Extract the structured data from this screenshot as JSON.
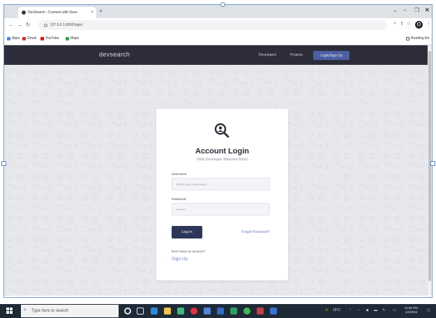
{
  "browser": {
    "tab_title": "DevSearch - Connect with Devs",
    "tab_close": "×",
    "new_tab": "+",
    "url": "127.0.0.1:8000/login/",
    "bookmarks": [
      {
        "label": "Apps",
        "color": "#4285f4"
      },
      {
        "label": "Gmail",
        "color": "#d93025"
      },
      {
        "label": "YouTube",
        "color": "#ff0000"
      },
      {
        "label": "Maps",
        "color": "#34a853"
      }
    ],
    "reading_list": "Reading list",
    "profile_initial": "O"
  },
  "navbar": {
    "logo": "devsearch",
    "links": [
      "Developers",
      "Projects"
    ],
    "cta": "Login/Sign Up"
  },
  "login": {
    "title": "Account Login",
    "subtitle": "Hello Developer, Welcome Back!",
    "username_label": "Username:",
    "username_placeholder": "Enter your username...",
    "password_label": "Password:",
    "password_value": "••••••••",
    "login_button": "Log In",
    "forgot_link": "Forget Password?",
    "no_account": "Don't have an account?",
    "signup_link": "Sign Up"
  },
  "taskbar": {
    "search_placeholder": "Type here to search",
    "weather": "18°C",
    "time": "11:55 PM",
    "date": "1/4/2022"
  },
  "colors": {
    "navbar_bg": "#2d2d39",
    "accent": "#4b5fa3",
    "button": "#2d3558",
    "link": "#6a80c8"
  }
}
